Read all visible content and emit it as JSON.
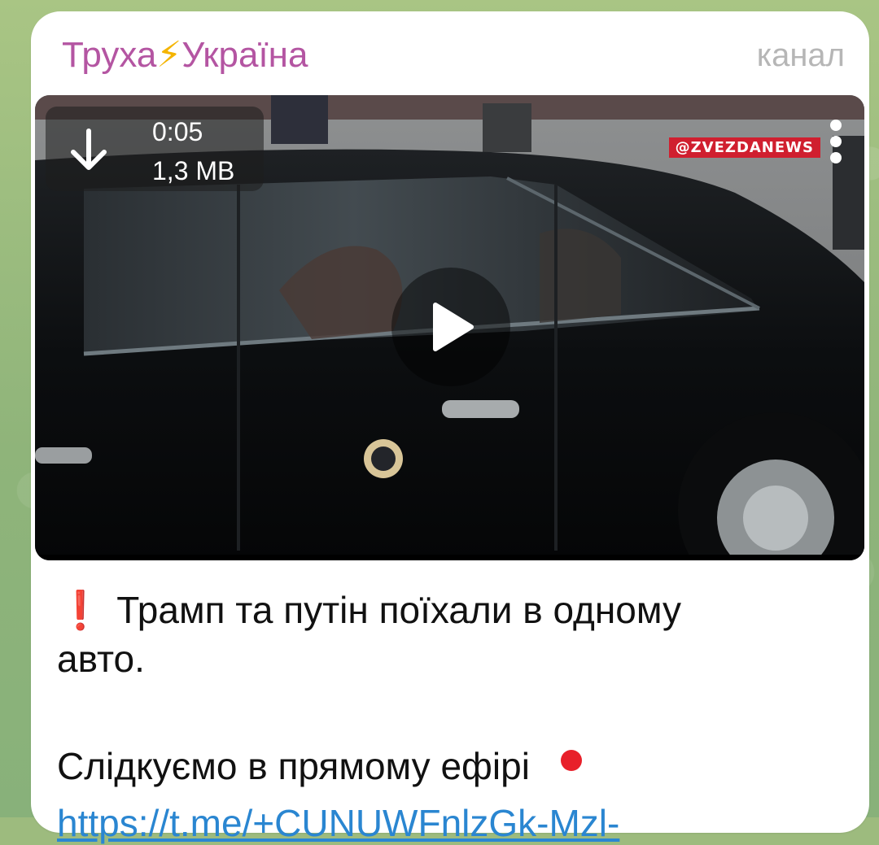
{
  "channel": {
    "name_part1": "Труха",
    "name_bolt": "⚡",
    "name_part2": "Україна",
    "type": "канал"
  },
  "video": {
    "duration": "0:05",
    "size": "1,3 MB",
    "watermark": "@ZVEZDANEWS",
    "download_icon": "download-arrow-icon",
    "play_icon": "play-icon",
    "menu_icon": "more-vertical-icon"
  },
  "post": {
    "emoji": "❗",
    "line1": "Трамп та путін поїхали в одному",
    "line2": "авто.",
    "line3": "Слідкуємо в прямому ефірі",
    "live_dot_color": "#e8202a",
    "link_partial": "https://t.me/+CUNUWFnlzGk-Mzl-"
  },
  "colors": {
    "channel_name": "#b455a2",
    "link": "#2a86d1",
    "background": "#9dbb7e"
  }
}
